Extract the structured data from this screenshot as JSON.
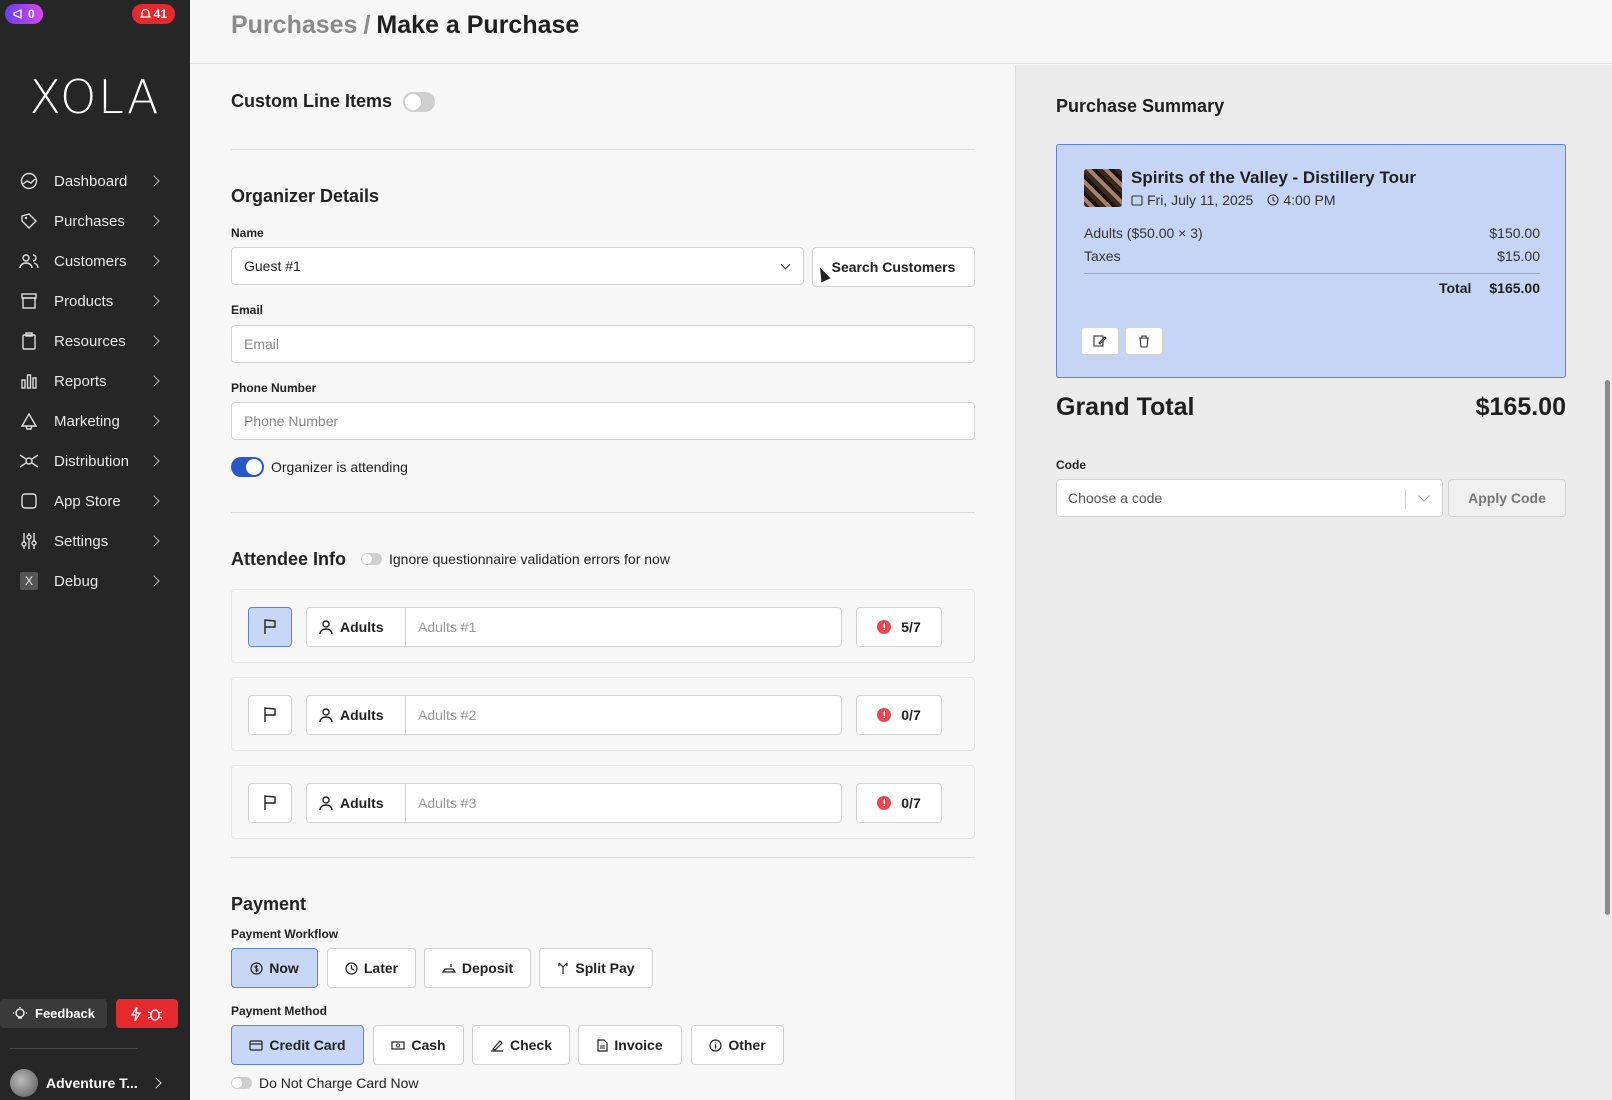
{
  "top_badges": {
    "left": "0",
    "right": "41"
  },
  "logo": "XOLA",
  "nav": [
    {
      "label": "Dashboard",
      "icon": "dashboard-icon"
    },
    {
      "label": "Purchases",
      "icon": "tag-icon"
    },
    {
      "label": "Customers",
      "icon": "users-icon"
    },
    {
      "label": "Products",
      "icon": "box-icon"
    },
    {
      "label": "Resources",
      "icon": "clipboard-icon"
    },
    {
      "label": "Reports",
      "icon": "bar-chart-icon"
    },
    {
      "label": "Marketing",
      "icon": "megaphone-icon"
    },
    {
      "label": "Distribution",
      "icon": "network-icon"
    },
    {
      "label": "App Store",
      "icon": "app-icon"
    },
    {
      "label": "Settings",
      "icon": "sliders-icon"
    },
    {
      "label": "Debug",
      "icon": "debug-x-icon"
    }
  ],
  "feedback_label": "Feedback",
  "account_name": "Adventure T...",
  "breadcrumb": {
    "parent": "Purchases",
    "separator": "/",
    "current": "Make a Purchase"
  },
  "custom_line_items": "Custom Line Items",
  "organizer": {
    "title": "Organizer Details",
    "name_label": "Name",
    "name_value": "Guest #1",
    "search_button": "Search Customers",
    "email_label": "Email",
    "email_placeholder": "Email",
    "phone_label": "Phone Number",
    "phone_placeholder": "Phone Number",
    "attending_label": "Organizer is attending"
  },
  "attendee": {
    "title": "Attendee Info",
    "ignore_label": "Ignore questionnaire validation errors for now",
    "rows": [
      {
        "type": "Adults",
        "placeholder": "Adults #1",
        "progress": "5/7"
      },
      {
        "type": "Adults",
        "placeholder": "Adults #2",
        "progress": "0/7"
      },
      {
        "type": "Adults",
        "placeholder": "Adults #3",
        "progress": "0/7"
      }
    ]
  },
  "payment": {
    "title": "Payment",
    "workflow_label": "Payment Workflow",
    "workflow": [
      "Now",
      "Later",
      "Deposit",
      "Split Pay"
    ],
    "method_label": "Payment Method",
    "methods": [
      "Credit Card",
      "Cash",
      "Check",
      "Invoice",
      "Other"
    ],
    "no_charge_label": "Do Not Charge Card Now"
  },
  "summary": {
    "title": "Purchase Summary",
    "item_title": "Spirits of the Valley - Distillery Tour",
    "date": "Fri, July 11, 2025",
    "time": "4:00 PM",
    "lines": [
      {
        "label": "Adults ($50.00 × 3)",
        "amount": "$150.00"
      },
      {
        "label": "Taxes",
        "amount": "$15.00"
      }
    ],
    "total_label": "Total",
    "total_amount": "$165.00",
    "grand_label": "Grand Total",
    "grand_amount": "$165.00",
    "code_label": "Code",
    "code_placeholder": "Choose a code",
    "apply_button": "Apply Code"
  },
  "colors": {
    "accent": "#2857c9",
    "selected_bg": "#c9d7f7",
    "error": "#e5494f",
    "sidebar": "#262626"
  }
}
